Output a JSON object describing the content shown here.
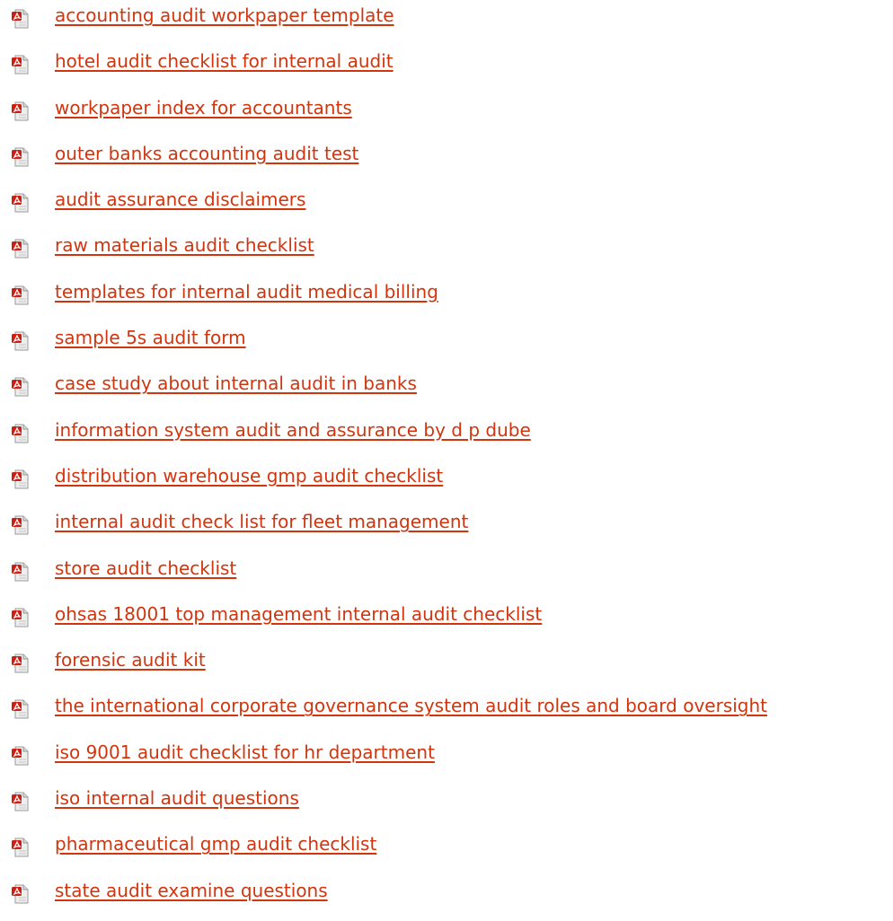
{
  "links": [
    {
      "label": "accounting audit workpaper template",
      "icon": "pdf-file-icon"
    },
    {
      "label": "hotel audit checklist for internal audit",
      "icon": "pdf-file-icon"
    },
    {
      "label": "workpaper index for accountants",
      "icon": "pdf-file-icon"
    },
    {
      "label": "outer banks accounting audit test",
      "icon": "pdf-file-icon"
    },
    {
      "label": "audit assurance disclaimers",
      "icon": "pdf-file-icon"
    },
    {
      "label": "raw materials audit checklist",
      "icon": "pdf-file-icon"
    },
    {
      "label": "templates for internal audit medical billing",
      "icon": "pdf-file-icon"
    },
    {
      "label": "sample 5s audit form",
      "icon": "pdf-file-icon"
    },
    {
      "label": "case study about internal audit in banks",
      "icon": "pdf-file-icon"
    },
    {
      "label": "information system audit and assurance by d p dube",
      "icon": "pdf-file-icon"
    },
    {
      "label": "distribution warehouse gmp audit checklist",
      "icon": "pdf-file-icon"
    },
    {
      "label": "internal audit check list for fleet management",
      "icon": "pdf-file-icon"
    },
    {
      "label": "store audit checklist",
      "icon": "pdf-file-icon"
    },
    {
      "label": "ohsas 18001 top management internal audit checklist",
      "icon": "pdf-file-icon"
    },
    {
      "label": "forensic audit kit",
      "icon": "pdf-file-icon"
    },
    {
      "label": "the international corporate governance system audit roles and board oversight",
      "icon": "pdf-file-icon"
    },
    {
      "label": "iso 9001 audit checklist for hr department",
      "icon": "pdf-file-icon"
    },
    {
      "label": "iso internal audit questions",
      "icon": "pdf-file-icon"
    },
    {
      "label": "pharmaceutical gmp audit checklist",
      "icon": "pdf-file-icon"
    },
    {
      "label": "state audit examine questions",
      "icon": "pdf-file-icon"
    }
  ],
  "colors": {
    "link": "#d2350e",
    "icon_red": "#cc1f14",
    "icon_paper": "#eeeeee"
  }
}
